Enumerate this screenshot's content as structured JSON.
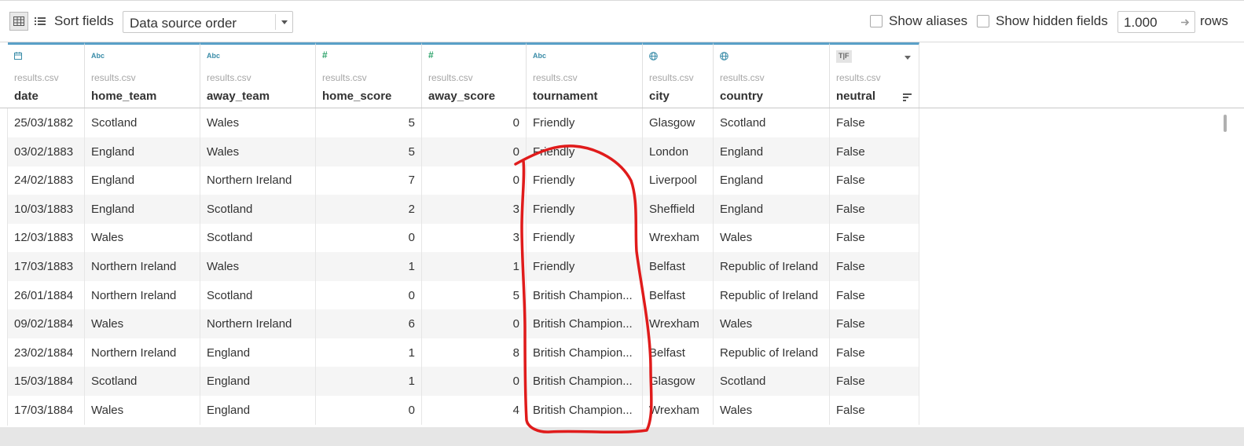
{
  "toolbar": {
    "sort_label": "Sort fields",
    "sort_value": "Data source order",
    "show_aliases": "Show aliases",
    "show_hidden": "Show hidden fields",
    "rows_value": "1.000",
    "rows_label": "rows"
  },
  "columns": [
    {
      "icon": "calendar-icon",
      "type": "",
      "source": "results.csv",
      "name": "date"
    },
    {
      "icon": "abc-icon",
      "type": "Abc",
      "source": "results.csv",
      "name": "home_team"
    },
    {
      "icon": "abc-icon",
      "type": "Abc",
      "source": "results.csv",
      "name": "away_team"
    },
    {
      "icon": "number-icon",
      "type": "#",
      "source": "results.csv",
      "name": "home_score"
    },
    {
      "icon": "number-icon",
      "type": "#",
      "source": "results.csv",
      "name": "away_score"
    },
    {
      "icon": "abc-icon",
      "type": "Abc",
      "source": "results.csv",
      "name": "tournament"
    },
    {
      "icon": "globe-icon",
      "type": "",
      "source": "results.csv",
      "name": "city"
    },
    {
      "icon": "globe-icon",
      "type": "",
      "source": "results.csv",
      "name": "country"
    },
    {
      "icon": "boolean-icon",
      "type": "T|F",
      "source": "results.csv",
      "name": "neutral"
    }
  ],
  "rows": [
    [
      "25/03/1882",
      "Scotland",
      "Wales",
      "5",
      "0",
      "Friendly",
      "Glasgow",
      "Scotland",
      "False"
    ],
    [
      "03/02/1883",
      "England",
      "Wales",
      "5",
      "0",
      "Friendly",
      "London",
      "England",
      "False"
    ],
    [
      "24/02/1883",
      "England",
      "Northern Ireland",
      "7",
      "0",
      "Friendly",
      "Liverpool",
      "England",
      "False"
    ],
    [
      "10/03/1883",
      "England",
      "Scotland",
      "2",
      "3",
      "Friendly",
      "Sheffield",
      "England",
      "False"
    ],
    [
      "12/03/1883",
      "Wales",
      "Scotland",
      "0",
      "3",
      "Friendly",
      "Wrexham",
      "Wales",
      "False"
    ],
    [
      "17/03/1883",
      "Northern Ireland",
      "Wales",
      "1",
      "1",
      "Friendly",
      "Belfast",
      "Republic of Ireland",
      "False"
    ],
    [
      "26/01/1884",
      "Northern Ireland",
      "Scotland",
      "0",
      "5",
      "British Champion...",
      "Belfast",
      "Republic of Ireland",
      "False"
    ],
    [
      "09/02/1884",
      "Wales",
      "Northern Ireland",
      "6",
      "0",
      "British Champion...",
      "Wrexham",
      "Wales",
      "False"
    ],
    [
      "23/02/1884",
      "Northern Ireland",
      "England",
      "1",
      "8",
      "British Champion...",
      "Belfast",
      "Republic of Ireland",
      "False"
    ],
    [
      "15/03/1884",
      "Scotland",
      "England",
      "1",
      "0",
      "British Champion...",
      "Glasgow",
      "Scotland",
      "False"
    ],
    [
      "17/03/1884",
      "Wales",
      "England",
      "0",
      "4",
      "British Champion...",
      "Wrexham",
      "Wales",
      "False"
    ]
  ],
  "colors": {
    "header_accent": "#5aa0c8",
    "annotation": "#e01b1b"
  }
}
